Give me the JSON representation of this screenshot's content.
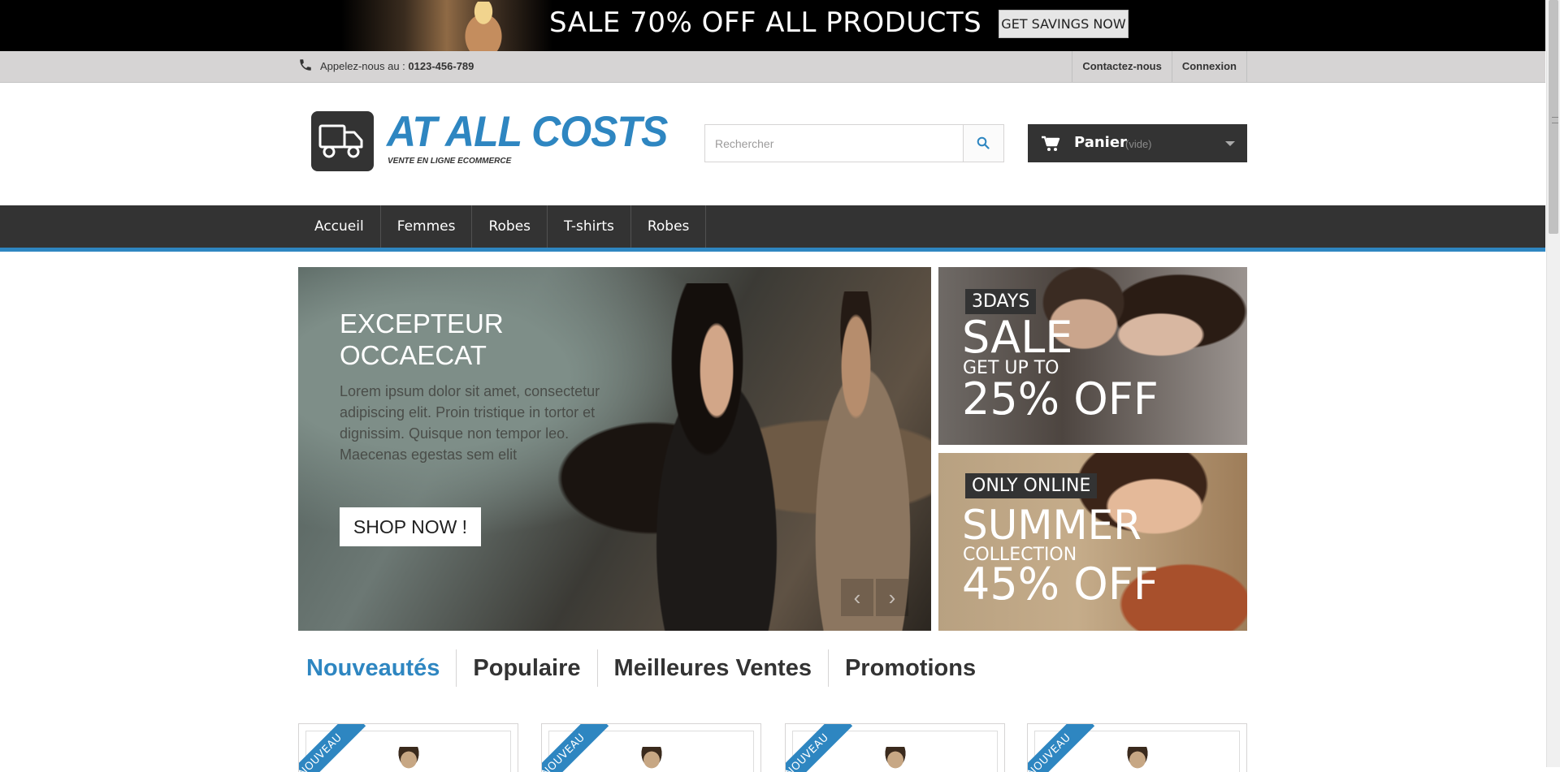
{
  "promo": {
    "headline": "SALE 70% OFF ALL PRODUCTS",
    "button": "GET SAVINGS NOW"
  },
  "contact_bar": {
    "call_label": "Appelez-nous au :",
    "phone": "0123-456-789",
    "links": [
      "Contactez-nous",
      "Connexion"
    ]
  },
  "header": {
    "logo_text": "AT ALL COSTS",
    "logo_tagline": "VENTE EN LIGNE ECOMMERCE",
    "search_placeholder": "Rechercher",
    "cart_label": "Panier",
    "cart_status": "(vide)"
  },
  "menu": {
    "items": [
      "Accueil",
      "Femmes",
      "Robes",
      "T-shirts",
      "Robes"
    ]
  },
  "slider": {
    "title": "EXCEPTEUR OCCAECAT",
    "text": "Lorem ipsum dolor sit amet, consectetur adipiscing elit. Proin tristique in tortor et dignissim. Quisque non tempor leo. Maecenas egestas sem elit",
    "button": "SHOP NOW !",
    "prev": "‹",
    "next": "›"
  },
  "banners": [
    {
      "tag": "3DAYS",
      "main": "SALE",
      "sub": "GET UP TO",
      "pct": "25% OFF"
    },
    {
      "tag": "ONLY ONLINE",
      "main": "SUMMER",
      "sub": "COLLECTION",
      "pct": "45% OFF"
    }
  ],
  "tabs": [
    "Nouveautés",
    "Populaire",
    "Meilleures Ventes",
    "Promotions"
  ],
  "products": {
    "ribbon": "NOUVEAU"
  },
  "colors": {
    "accent": "#2e86c1",
    "dark": "#333333",
    "bar_gray": "#d6d4d4"
  }
}
